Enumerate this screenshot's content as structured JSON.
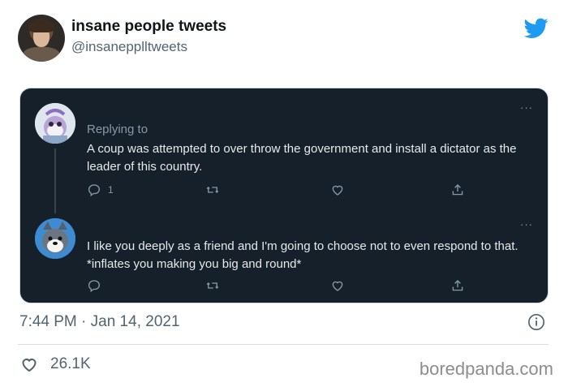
{
  "tweet": {
    "display_name": "insane people tweets",
    "handle": "@insanepplltweets",
    "timestamp": "7:44 PM · Jan 14, 2021",
    "likes": "26.1K"
  },
  "embedded": {
    "more_glyph": "···",
    "first": {
      "replying_label": "Replying to",
      "text": "A coup was attempted to over throw the government and install a dictator as the leader of this country.",
      "reply_count": "1"
    },
    "second": {
      "text": "I like you deeply as a friend and I'm going to choose not to even respond to that. *inflates you making you big and round*"
    }
  },
  "watermark": "boredpanda.com",
  "colors": {
    "twitter_blue": "#1d9bf0",
    "dark_card": "#15202b",
    "muted": "#8899a6"
  },
  "icons": [
    "twitter-bird-icon",
    "reply-icon",
    "retweet-icon",
    "like-icon",
    "share-icon",
    "info-icon",
    "heart-icon"
  ]
}
